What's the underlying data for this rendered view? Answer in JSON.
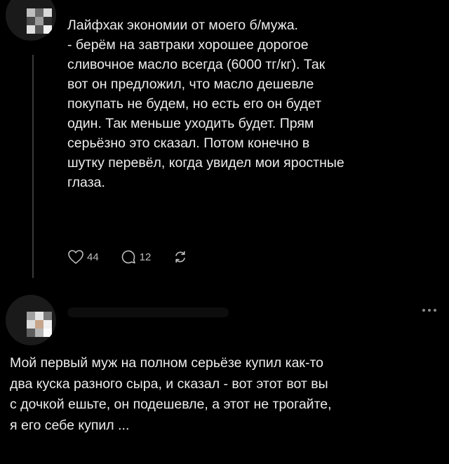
{
  "post1": {
    "text": "Лайфхак экономии от моего б/мужа.\n- берём на завтраки хорошее дорогое\nсливочное масло всегда (6000 тг/кг). Так\nвот он предложил, что масло дешевле\nпокупать не будем, но есть его он будет\nодин. Так меньше уходить будет. Прям\nсерьёзно это сказал.  Потом конечно в\nшутку перевёл, когда увидел мои яростные\nглаза.",
    "likes": "44",
    "replies": "12"
  },
  "post2": {
    "text": "Мой первый муж на полном серьёзе купил как-то\nдва куска разного сыра, и сказал - вот этот вот вы\nс дочкой ешьте, он подешевле, а этот не трогайте,\nя его себе купил ..."
  },
  "icons": {
    "like": "heart-icon",
    "reply": "comment-icon",
    "share": "repost-icon",
    "more": "more-dots-icon"
  },
  "colors": {
    "background": "#000000",
    "text": "#ececec",
    "icon": "#bdbdbd"
  }
}
